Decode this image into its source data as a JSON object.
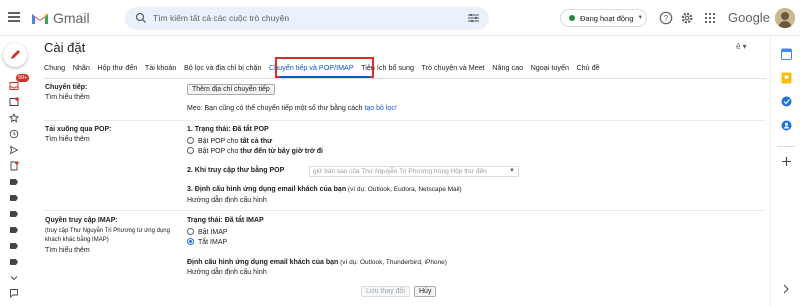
{
  "header": {
    "app_name": "Gmail",
    "search_placeholder": "Tìm kiếm tất cả các cuộc trò chuyện",
    "status_label": "Đang hoạt động",
    "brand": "Google"
  },
  "sidebar": {
    "inbox_badge": "99+"
  },
  "page": {
    "title": "Cài đặt",
    "language_toggle": "ê ▾"
  },
  "tabs": [
    {
      "label": "Chung"
    },
    {
      "label": "Nhãn"
    },
    {
      "label": "Hộp thư đến"
    },
    {
      "label": "Tài khoản"
    },
    {
      "label": "Bộ lọc và địa chỉ bị chặn"
    },
    {
      "label": "Chuyển tiếp và POP/IMAP"
    },
    {
      "label": "Tiện ích bổ sung"
    },
    {
      "label": "Trò chuyện và Meet"
    },
    {
      "label": "Nâng cao"
    },
    {
      "label": "Ngoại tuyến"
    },
    {
      "label": "Chủ đề"
    }
  ],
  "forwarding": {
    "label": "Chuyển tiếp:",
    "learn_more": "Tìm hiểu thêm",
    "add_button": "Thêm địa chỉ chuyển tiếp",
    "tip_prefix": "Mẹo: Bạn cũng có thể chuyển tiếp một số thư bằng cách ",
    "tip_link": "tạo bộ lọc!"
  },
  "pop": {
    "label": "Tải xuống qua POP:",
    "learn_more": "Tìm hiểu thêm",
    "status": "1. Trạng thái: Đã tắt POP",
    "opt1_prefix": "Bật POP cho ",
    "opt1_bold": "tất cả thư",
    "opt2_prefix": "Bật POP cho ",
    "opt2_bold": "thư đến từ bây giờ trở đi",
    "step2": "2. Khi truy cập thư bằng POP",
    "step2_select": "giữ bản sao của Thư Nguyễn Tri Phương trong Hộp thư đến",
    "step3_bold": "3. Định cấu hình ứng dụng email khách của bạn",
    "step3_rest": " (ví dụ: Outlook, Eudora, Netscape Mail)",
    "config_link": "Hướng dẫn định cấu hình"
  },
  "imap": {
    "label": "Quyền truy cập IMAP:",
    "desc_line1": "(truy cập Thư Nguyễn Tri Phương từ ứng dụng",
    "desc_line2": "khách khác bằng IMAP)",
    "learn_more": "Tìm hiểu thêm",
    "status": "Trạng thái: Đã tắt IMAP",
    "opt_on": "Bật IMAP",
    "opt_off": "Tắt IMAP",
    "config_bold": "Định cấu hình ứng dụng email khách của bạn",
    "config_rest": " (ví dụ: Outlook, Thunderbird, iPhone)",
    "config_link": "Hướng dẫn định cấu hình"
  },
  "footer": {
    "save": "Lưu thay đổi",
    "cancel": "Hủy"
  },
  "colors": {
    "accent": "#0b57d0",
    "highlight_box": "#d93025",
    "link": "#1a57d6"
  }
}
